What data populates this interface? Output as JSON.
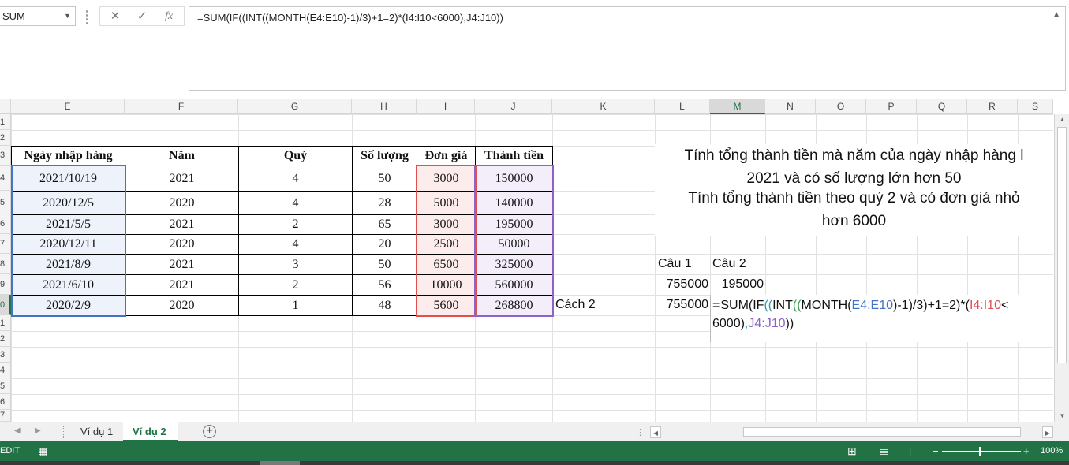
{
  "formula_bar": {
    "name_box": "SUM",
    "cancel_glyph": "✕",
    "enter_glyph": "✓",
    "fx_glyph": "fx",
    "formula": "=SUM(IF((INT((MONTH(E4:E10)-1)/3)+1=2)*(I4:I10<6000),J4:J10))"
  },
  "columns": [
    "E",
    "F",
    "G",
    "H",
    "I",
    "J",
    "K",
    "L",
    "M",
    "N",
    "O",
    "P",
    "Q",
    "R",
    "S"
  ],
  "selected_column": "M",
  "rows": [
    "1",
    "2",
    "3",
    "4",
    "5",
    "6",
    "7",
    "8",
    "9",
    "0",
    "1",
    "2",
    "3",
    "4",
    "5",
    "6",
    "7"
  ],
  "selected_row_index": 9,
  "table": {
    "headers": [
      "Ngày nhập hàng",
      "Năm",
      "Quý",
      "Số lượng",
      "Đơn giá",
      "Thành tiền"
    ],
    "rows": [
      [
        "2021/10/19",
        "2021",
        "4",
        "50",
        "3000",
        "150000"
      ],
      [
        "2020/12/5",
        "2020",
        "4",
        "28",
        "5000",
        "140000"
      ],
      [
        "2021/5/5",
        "2021",
        "2",
        "65",
        "3000",
        "195000"
      ],
      [
        "2020/12/11",
        "2020",
        "4",
        "20",
        "2500",
        "50000"
      ],
      [
        "2021/8/9",
        "2021",
        "3",
        "50",
        "6500",
        "325000"
      ],
      [
        "2021/6/10",
        "2021",
        "2",
        "56",
        "10000",
        "560000"
      ],
      [
        "2020/2/9",
        "2020",
        "1",
        "48",
        "5600",
        "268800"
      ]
    ]
  },
  "notes": {
    "q1_line1": "Tính tổng thành tiền mà năm của ngày nhập hàng l",
    "q1_line2": "2021 và có số lượng lớn hơn 50",
    "q2_line1": "Tính tổng thành tiền theo quý 2 và có đơn giá nhỏ",
    "q2_line2": "hơn 6000"
  },
  "answers": {
    "cau1_label": "Câu 1",
    "cau2_label": "Câu 2",
    "cau1_value_1": "755000",
    "cau2_value_1": "195000",
    "cach2_label": "Cách 2",
    "cau1_value_2": "755000"
  },
  "editing_formula": {
    "p1": "=",
    "p2": "SUM(IF",
    "p3": "((",
    "p4": "INT",
    "p5": "((",
    "p6": "MONTH(",
    "p7": "E4:E10",
    "p8": ")-1)/3)+1=2)*(",
    "p9": "I4:I10",
    "p10": "<",
    "p11": "6000)",
    "p12": ",",
    "p13": "J4:J10",
    "p14": "))"
  },
  "sheet_tabs": [
    "Ví dụ 1",
    "Ví dụ 2"
  ],
  "active_tab": "Ví dụ 2",
  "status": {
    "mode": "EDIT",
    "zoom": "100%"
  },
  "colors": {
    "excel_green": "#217346",
    "ref_blue": "#4472c4",
    "ref_red": "#e05050",
    "ref_purple": "#8e63c7"
  }
}
